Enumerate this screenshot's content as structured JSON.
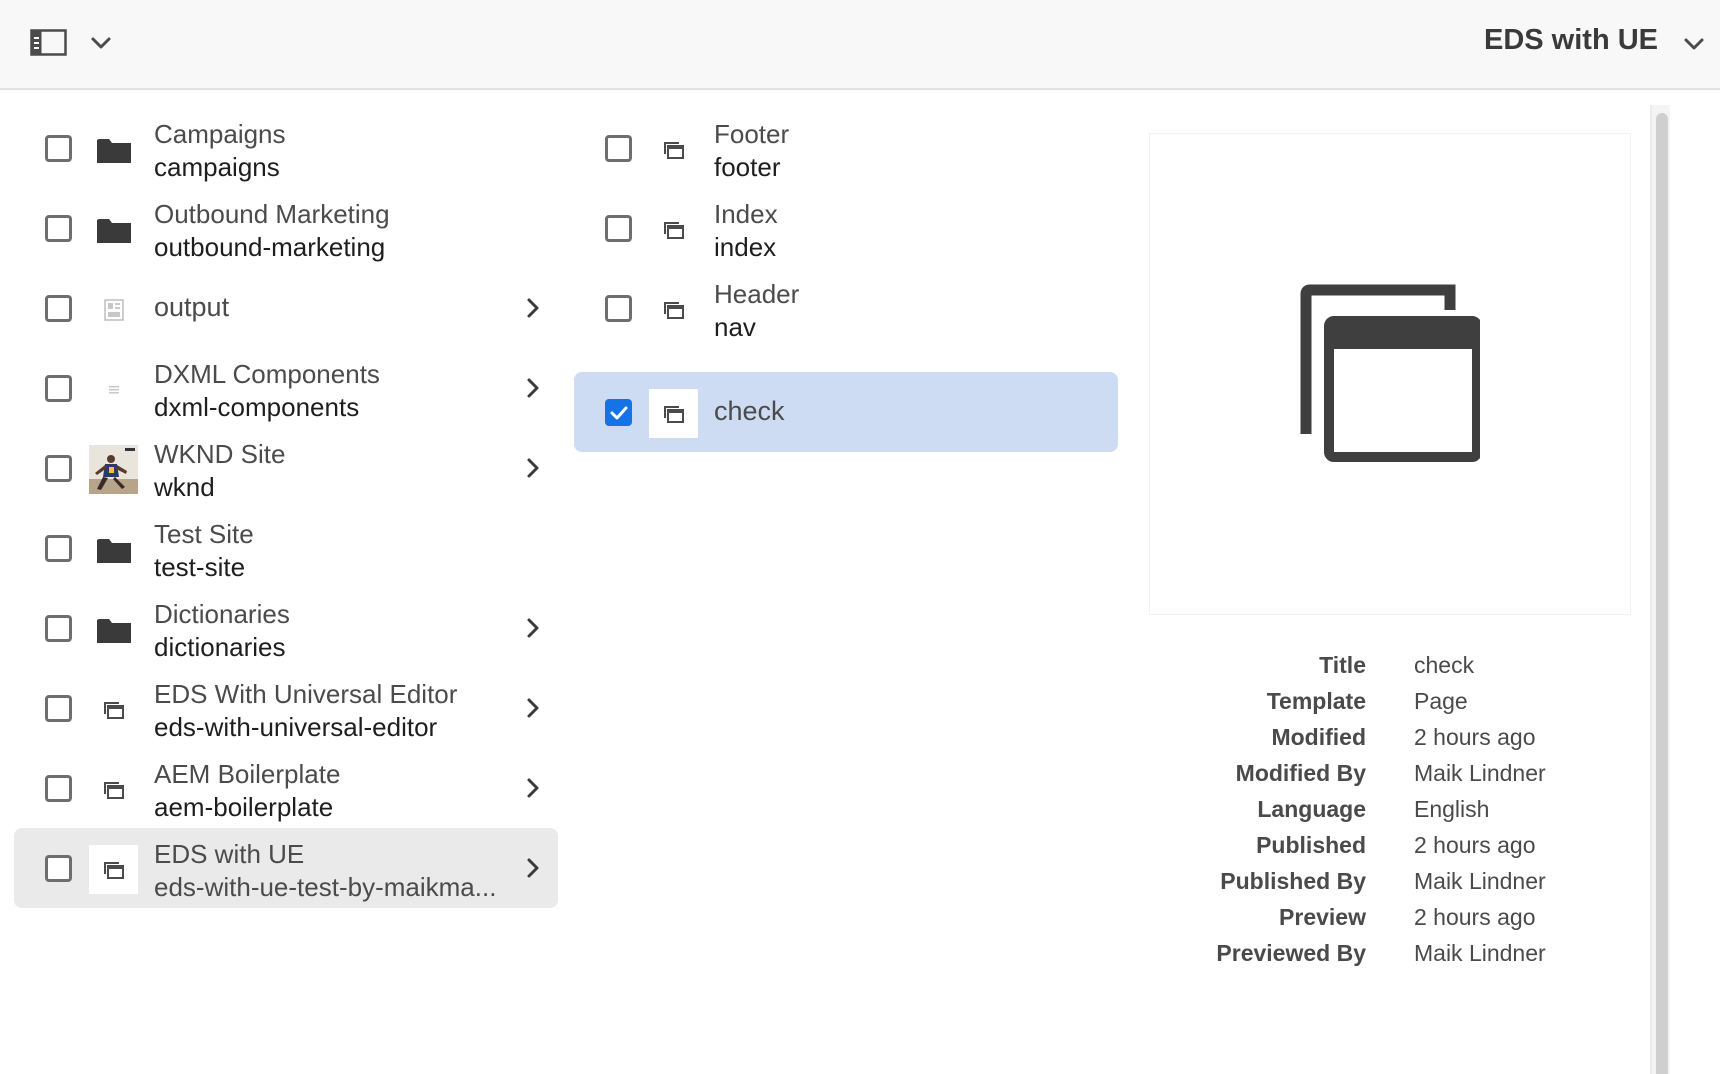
{
  "header": {
    "site_title": "EDS with UE",
    "rail_toggle_icon": "rail-toggle-icon",
    "chevron_icon": "chevron-down-icon"
  },
  "column1": {
    "items": [
      {
        "title": "Campaigns",
        "name": "campaigns",
        "icon": "folder-icon",
        "has_children": false,
        "checked": false
      },
      {
        "title": "Outbound Marketing",
        "name": "outbound-marketing",
        "icon": "folder-icon",
        "has_children": false,
        "checked": false
      },
      {
        "title": "output",
        "name": "",
        "icon": "page-layout-icon",
        "has_children": true,
        "checked": false
      },
      {
        "title": "DXML Components",
        "name": "dxml-components",
        "icon": "document-icon",
        "has_children": true,
        "checked": false
      },
      {
        "title": "WKND Site",
        "name": "wknd",
        "icon": "wknd-thumbnail",
        "has_children": true,
        "checked": false
      },
      {
        "title": "Test Site",
        "name": "test-site",
        "icon": "folder-icon",
        "has_children": false,
        "checked": false
      },
      {
        "title": "Dictionaries",
        "name": "dictionaries",
        "icon": "folder-icon",
        "has_children": true,
        "checked": false
      },
      {
        "title": "EDS With Universal Editor",
        "name": "eds-with-universal-editor",
        "icon": "page-icon",
        "has_children": true,
        "checked": false
      },
      {
        "title": "AEM Boilerplate",
        "name": "aem-boilerplate",
        "icon": "page-icon",
        "has_children": true,
        "checked": false
      },
      {
        "title": "EDS with UE",
        "name": "eds-with-ue-test-by-maikma...",
        "icon": "page-icon",
        "has_children": true,
        "checked": false
      }
    ]
  },
  "column2": {
    "items": [
      {
        "title": "Footer",
        "name": "footer",
        "icon": "page-icon",
        "checked": false
      },
      {
        "title": "Index",
        "name": "index",
        "icon": "page-icon",
        "checked": false
      },
      {
        "title": "Header",
        "name": "nav",
        "icon": "page-icon",
        "checked": false
      },
      {
        "title": "check",
        "name": "",
        "icon": "page-icon",
        "checked": true
      }
    ]
  },
  "preview": {
    "icon": "page-preview-icon",
    "meta": [
      {
        "label": "Title",
        "value": "check"
      },
      {
        "label": "Template",
        "value": "Page"
      },
      {
        "label": "Modified",
        "value": "2 hours ago"
      },
      {
        "label": "Modified By",
        "value": "Maik Lindner"
      },
      {
        "label": "Language",
        "value": "English"
      },
      {
        "label": "Published",
        "value": "2 hours ago"
      },
      {
        "label": "Published By",
        "value": "Maik Lindner"
      },
      {
        "label": "Preview",
        "value": "2 hours ago"
      },
      {
        "label": "Previewed By",
        "value": "Maik Lindner"
      }
    ]
  },
  "colors": {
    "accent": "#1473e6",
    "selected_bg": "#cddcf3",
    "hover_bg": "#eaeaea"
  }
}
